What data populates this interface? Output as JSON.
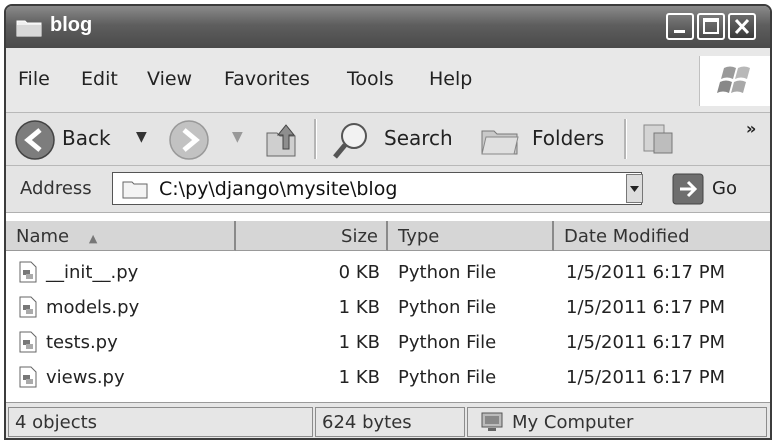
{
  "window": {
    "title": "blog"
  },
  "menu": {
    "items": [
      "File",
      "Edit",
      "View",
      "Favorites",
      "Tools",
      "Help"
    ]
  },
  "toolbar": {
    "back_label": "Back",
    "search_label": "Search",
    "folders_label": "Folders",
    "chevron": "»"
  },
  "address": {
    "label": "Address",
    "value": "C:\\py\\django\\mysite\\blog",
    "go_label": "Go"
  },
  "list": {
    "columns": [
      "Name",
      "Size",
      "Type",
      "Date Modified"
    ],
    "rows": [
      {
        "name": "__init__.py",
        "size": "0 KB",
        "type": "Python File",
        "modified": "1/5/2011 6:17 PM"
      },
      {
        "name": "models.py",
        "size": "1 KB",
        "type": "Python File",
        "modified": "1/5/2011 6:17 PM"
      },
      {
        "name": "tests.py",
        "size": "1 KB",
        "type": "Python File",
        "modified": "1/5/2011 6:17 PM"
      },
      {
        "name": "views.py",
        "size": "1 KB",
        "type": "Python File",
        "modified": "1/5/2011 6:17 PM"
      }
    ]
  },
  "status": {
    "objects": "4 objects",
    "size": "624 bytes",
    "location": "My Computer"
  },
  "icons": {
    "folder": "folder-icon",
    "back": "back-arrow-icon",
    "forward": "forward-arrow-icon",
    "up": "up-folder-icon",
    "search": "search-magnifier-icon",
    "folders": "folders-icon",
    "views": "views-icon",
    "go": "go-arrow-icon",
    "python_file": "python-file-icon",
    "computer": "my-computer-icon",
    "logo": "windows-logo-icon"
  }
}
